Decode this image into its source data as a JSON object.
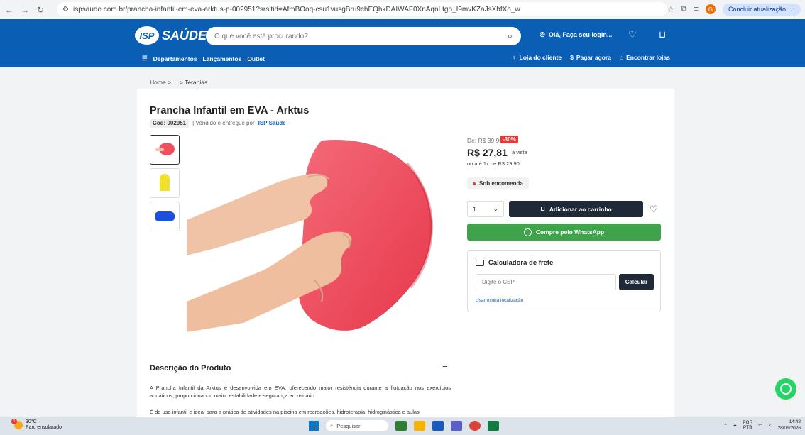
{
  "browser": {
    "url": "ispsaude.com.br/prancha-infantil-em-eva-arktus-p-002951?srsltid=AfmBOoq-csu1vusgBru9chEQhkDAIWAF0XnAqnLtgo_I9mvKZaJsXhfXo_w",
    "update_button": "Concluir atualização",
    "profile_initial": "G"
  },
  "header": {
    "logo_badge": "ISP",
    "logo_text": "SAÚDE",
    "search_placeholder": "O que você está procurando?",
    "login_text": "Olá, Faça seu login...",
    "nav": [
      "Departamentos",
      "Lançamentos",
      "Outlet"
    ],
    "links": {
      "customer_area": "Loja do cliente",
      "pay_now": "Pagar agora",
      "find_stores": "Encontrar lojas"
    }
  },
  "breadcrumb": {
    "home": "Home",
    "ellipsis": "...",
    "current": "Terapias",
    "separator": ">"
  },
  "product": {
    "title": "Prancha Infantil em EVA - Arktus",
    "code": "Cód: 002951",
    "sold_by_prefix": "| Vendido e entregue por",
    "seller": "ISP Saúde",
    "old_price": "De: R$ 39,90",
    "discount": "-30%",
    "price": "R$ 27,81",
    "price_note": "à vista",
    "installment": "ou até 1x de R$ 29,90",
    "availability": "Sob encomenda",
    "quantity": "1",
    "add_to_cart": "Adicionar ao carrinho",
    "whatsapp": "Compre pelo WhatsApp"
  },
  "freight": {
    "title": "Calculadora de frete",
    "cep_placeholder": "Digite o CEP",
    "calculate": "Calcular",
    "use_location": "Usar minha localização"
  },
  "description": {
    "title": "Descrição do Produto",
    "toggle": "−",
    "p1": "A Prancha Infantil da Arktus é desenvolvida em EVA, oferecendo maior resistência durante a flutuação nos exercícios aquáticos, proporcionando maior estabilidade e segurança ao usuário.",
    "p2": "É de uso infantil e ideal para a prática de atividades na piscina em recreações, hidroterapia, hidroginástica e aulas"
  },
  "taskbar": {
    "temperature": "30°C",
    "weather": "Parc ensolarado",
    "search": "Pesquisar",
    "lang_top": "POR",
    "lang_bottom": "PTB",
    "time": "14:48",
    "date": "28/01/2026"
  },
  "colors": {
    "brand_blue": "#0a5fb4",
    "dark_button": "#1f2937",
    "whatsapp_green": "#3ea34a",
    "discount_red": "#e53935",
    "board_red": "#ef4f5e"
  }
}
